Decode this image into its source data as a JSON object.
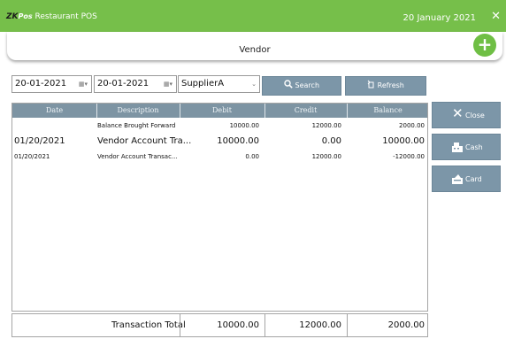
{
  "app": {
    "brand_zk": "ZK",
    "brand_pos": "Pos",
    "brand_name": "Restaurant POS",
    "date": "20 January 2021",
    "close_glyph": "✕"
  },
  "header": {
    "title": "Vendor",
    "add_glyph": "+"
  },
  "filters": {
    "from_date": "20-01-2021",
    "to_date": "20-01-2021",
    "supplier": "SupplierA",
    "search_label": "Search",
    "refresh_label": "Refresh"
  },
  "table": {
    "columns": [
      "Date",
      "Description",
      "Debit",
      "Credit",
      "Balance"
    ],
    "rows": [
      {
        "date": "",
        "description": "Balance Brought Forward",
        "debit": "10000.00",
        "credit": "12000.00",
        "balance": "2000.00"
      },
      {
        "date": "01/20/2021",
        "description": "Vendor Account Tra...",
        "debit": "10000.00",
        "credit": "0.00",
        "balance": "10000.00"
      },
      {
        "date": "01/20/2021",
        "description": "Vendor Account Transac...",
        "debit": "0.00",
        "credit": "12000.00",
        "balance": "-12000.00"
      }
    ]
  },
  "totals": {
    "label": "Transaction Total",
    "debit": "10000.00",
    "credit": "12000.00",
    "balance": "2000.00"
  },
  "actions": {
    "close_label": "Close",
    "cash_label": "Cash",
    "card_label": "Card"
  },
  "colors": {
    "titlebar": "#76bf4a",
    "button": "#7c96a8",
    "grid_header": "#7d94a3"
  },
  "icons": {
    "search": "search-icon",
    "refresh": "refresh-icon",
    "close": "x-icon",
    "cash": "cash-register-icon",
    "card": "card-icon"
  }
}
